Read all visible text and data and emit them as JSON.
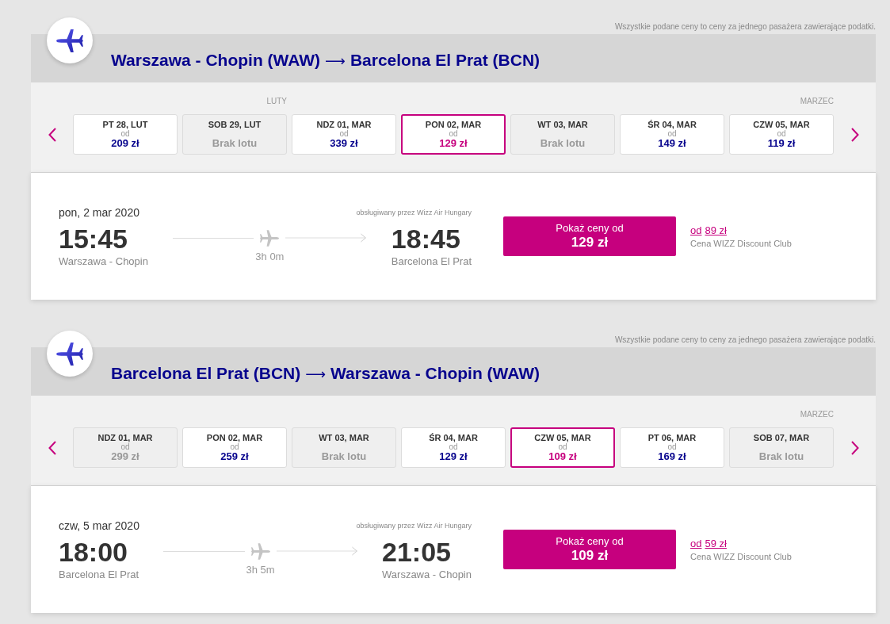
{
  "sections": [
    {
      "note": "Wszystkie podane ceny to ceny za jednego pasażera zawierające podatki.",
      "route": {
        "from": "Warszawa - Chopin (WAW)",
        "arrow": "⟶",
        "to": "Barcelona El Prat (BCN)"
      },
      "date_strip": {
        "days": [
          {
            "kind": "price",
            "label": "PT 28, LUT",
            "from": "od",
            "price": "209 zł",
            "selected": false,
            "disabled": false
          },
          {
            "kind": "no_flight",
            "month_label": "LUTY",
            "label": "SOB 29, LUT",
            "status": "Brak lotu",
            "selected": false,
            "disabled": true
          },
          {
            "kind": "price",
            "label": "NDZ 01, MAR",
            "from": "od",
            "price": "339 zł",
            "selected": false,
            "disabled": false
          },
          {
            "kind": "price",
            "label": "PON 02, MAR",
            "from": "od",
            "price": "129 zł",
            "selected": true,
            "disabled": false
          },
          {
            "kind": "no_flight",
            "label": "WT 03, MAR",
            "status": "Brak lotu",
            "selected": false,
            "disabled": true
          },
          {
            "kind": "price",
            "label": "ŚR 04, MAR",
            "from": "od",
            "price": "149 zł",
            "selected": false,
            "disabled": false
          },
          {
            "kind": "price",
            "month_label": "MARZEC",
            "label": "CZW 05, MAR",
            "from": "od",
            "price": "119 zł",
            "selected": false,
            "disabled": false
          }
        ]
      },
      "flight": {
        "date": "pon, 2 mar 2020",
        "operator": "obsługiwany przez Wizz Air Hungary",
        "departure": {
          "time": "15:45",
          "airport": "Warszawa - Chopin"
        },
        "duration": "3h 0m",
        "arrival": {
          "time": "18:45",
          "airport": "Barcelona El Prat"
        },
        "button": {
          "label": "Pokaż ceny od",
          "price": "129 zł"
        },
        "club": {
          "from": "od",
          "price": "89 zł",
          "label": "Cena WIZZ Discount Club"
        }
      }
    },
    {
      "note": "Wszystkie podane ceny to ceny za jednego pasażera zawierające podatki.",
      "route": {
        "from": "Barcelona El Prat (BCN)",
        "arrow": "⟶",
        "to": "Warszawa - Chopin (WAW)"
      },
      "date_strip": {
        "days": [
          {
            "kind": "price",
            "label": "NDZ 01, MAR",
            "from": "od",
            "price": "299 zł",
            "selected": false,
            "disabled": true
          },
          {
            "kind": "price",
            "label": "PON 02, MAR",
            "from": "od",
            "price": "259 zł",
            "selected": false,
            "disabled": false
          },
          {
            "kind": "no_flight",
            "label": "WT 03, MAR",
            "status": "Brak lotu",
            "selected": false,
            "disabled": true
          },
          {
            "kind": "price",
            "label": "ŚR 04, MAR",
            "from": "od",
            "price": "129 zł",
            "selected": false,
            "disabled": false
          },
          {
            "kind": "price",
            "label": "CZW 05, MAR",
            "from": "od",
            "price": "109 zł",
            "selected": true,
            "disabled": false
          },
          {
            "kind": "price",
            "label": "PT 06, MAR",
            "from": "od",
            "price": "169 zł",
            "selected": false,
            "disabled": false
          },
          {
            "kind": "no_flight",
            "month_label": "MARZEC",
            "label": "SOB 07, MAR",
            "status": "Brak lotu",
            "selected": false,
            "disabled": true
          }
        ]
      },
      "flight": {
        "date": "czw, 5 mar 2020",
        "operator": "obsługiwany przez Wizz Air Hungary",
        "departure": {
          "time": "18:00",
          "airport": "Barcelona El Prat"
        },
        "duration": "3h 5m",
        "arrival": {
          "time": "21:05",
          "airport": "Warszawa - Chopin"
        },
        "button": {
          "label": "Pokaż ceny od",
          "price": "109 zł"
        },
        "club": {
          "from": "od",
          "price": "59 zł",
          "label": "Cena WIZZ Discount Club"
        }
      }
    }
  ]
}
